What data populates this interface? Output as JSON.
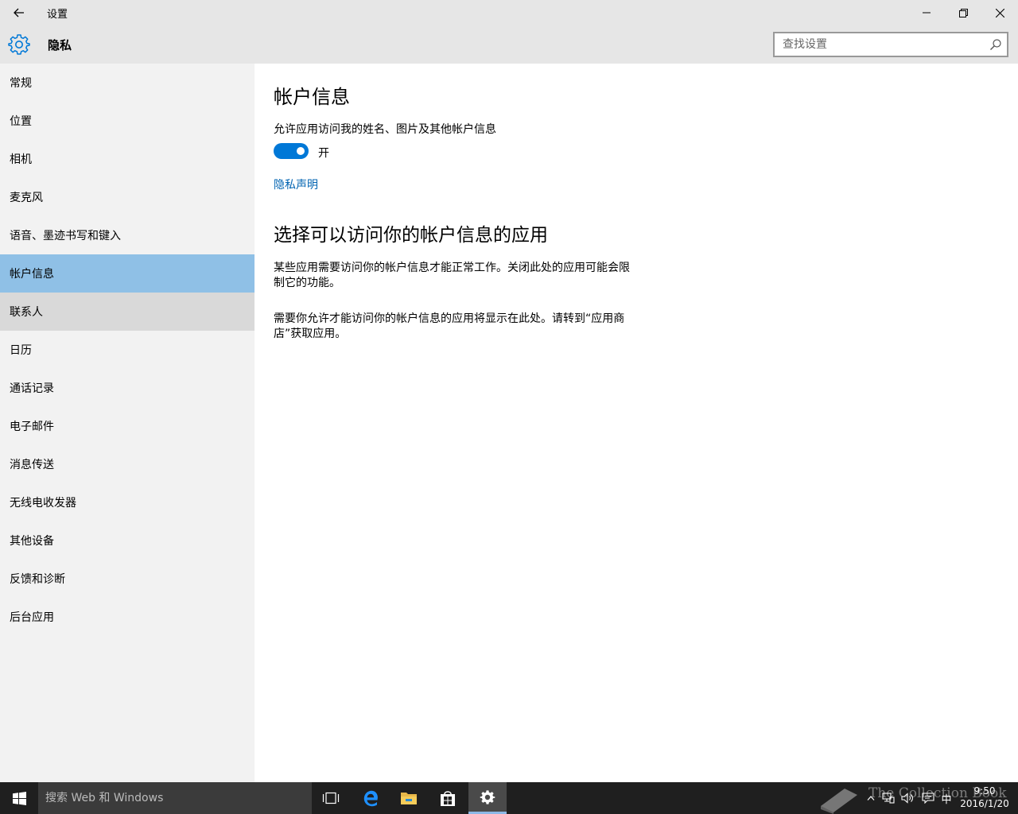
{
  "titlebar": {
    "back_icon": "arrow-left-icon",
    "title": "设置",
    "buttons": [
      "minimize-icon",
      "restore-icon",
      "close-icon"
    ]
  },
  "header": {
    "icon": "gear-icon",
    "title": "隐私",
    "search_placeholder": "查找设置"
  },
  "sidebar": {
    "items": [
      {
        "label": "常规"
      },
      {
        "label": "位置"
      },
      {
        "label": "相机"
      },
      {
        "label": "麦克风"
      },
      {
        "label": "语音、墨迹书写和键入"
      },
      {
        "label": "帐户信息",
        "selected": true
      },
      {
        "label": "联系人",
        "hovered": true
      },
      {
        "label": "日历"
      },
      {
        "label": "通话记录"
      },
      {
        "label": "电子邮件"
      },
      {
        "label": "消息传送"
      },
      {
        "label": "无线电收发器"
      },
      {
        "label": "其他设备"
      },
      {
        "label": "反馈和诊断"
      },
      {
        "label": "后台应用"
      }
    ]
  },
  "content": {
    "title": "帐户信息",
    "toggle_label": "允许应用访问我的姓名、图片及其他帐户信息",
    "toggle_state": "开",
    "toggle_on": true,
    "privacy_link": "隐私声明",
    "section_title": "选择可以访问你的帐户信息的应用",
    "paragraph1": "某些应用需要访问你的帐户信息才能正常工作。关闭此处的应用可能会限制它的功能。",
    "paragraph2": "需要你允许才能访问你的帐户信息的应用将显示在此处。请转到“应用商店”获取应用。"
  },
  "taskbar": {
    "search_placeholder": "搜索 Web 和 Windows",
    "apps": [
      "task-view-icon",
      "edge-icon",
      "file-explorer-icon",
      "store-icon",
      "settings-icon"
    ],
    "tray": {
      "ime": "中",
      "time": "9:50",
      "date": "2016/1/20"
    },
    "watermark": "The Collection Book"
  },
  "colors": {
    "accent": "#0078d7",
    "selected_nav": "#8fc0e6",
    "link": "#0063b1",
    "taskbar": "#1f1f1f"
  }
}
